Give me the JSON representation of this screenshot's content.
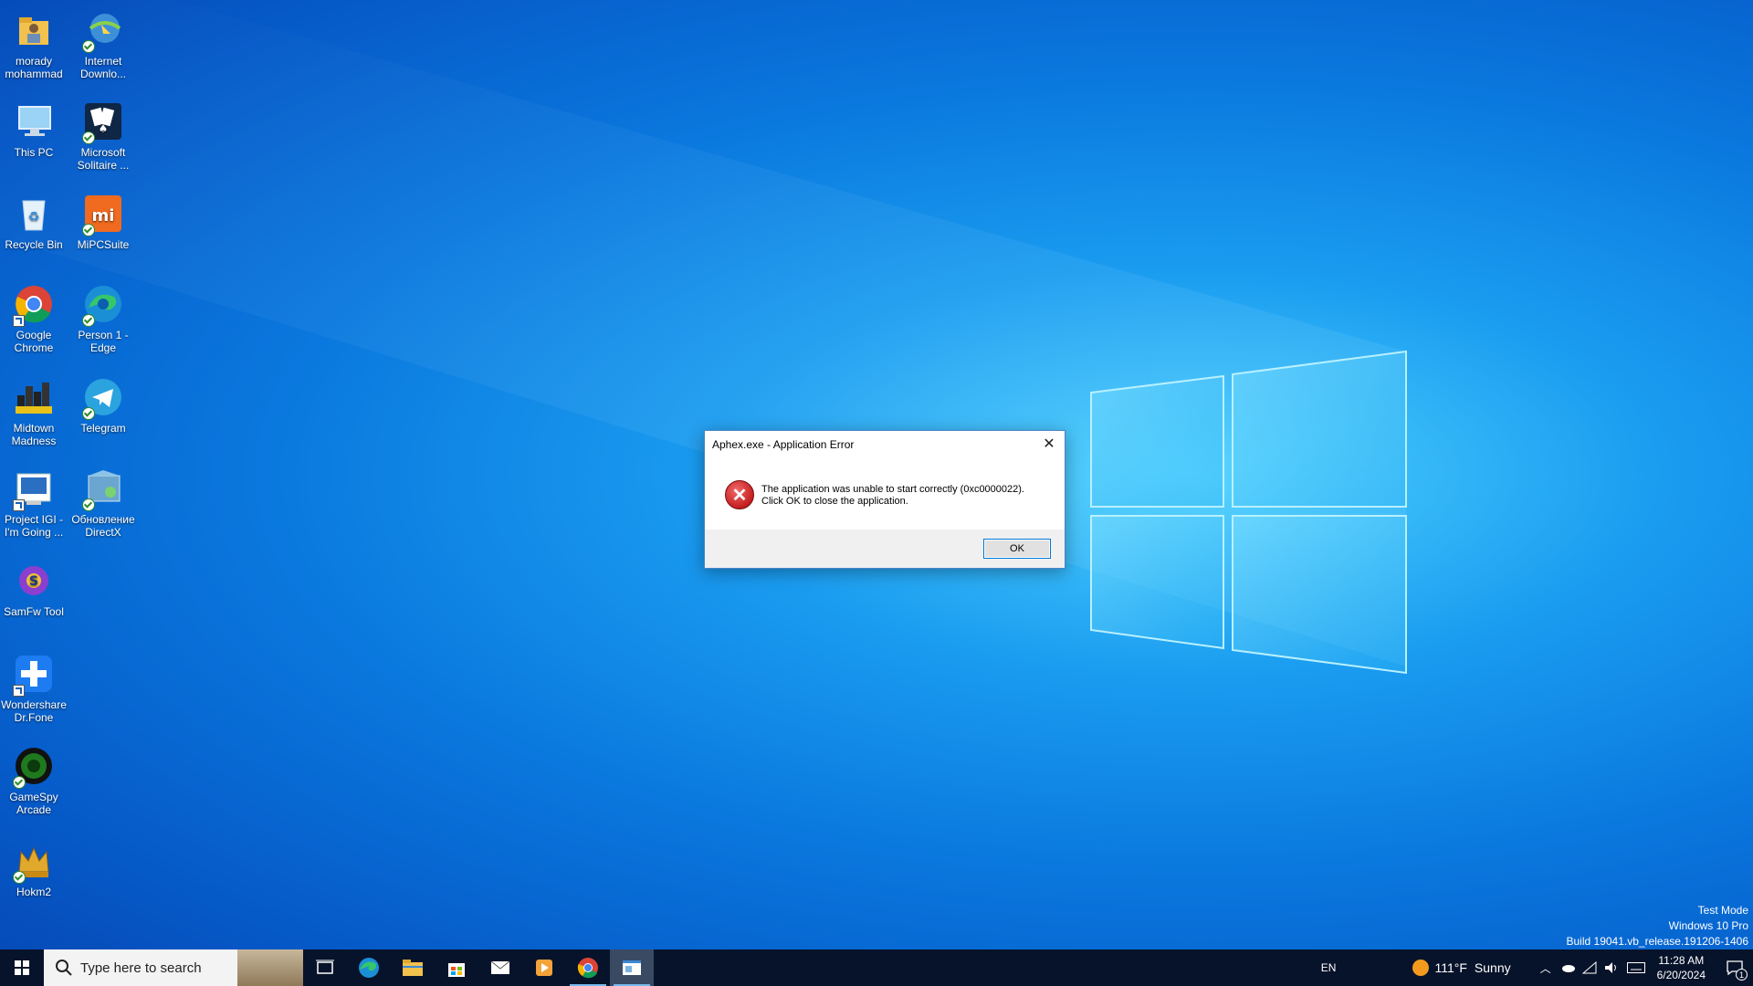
{
  "desktop": {
    "icons": [
      {
        "label": "morady mohammad",
        "icon": "user-folder-icon"
      },
      {
        "label": "Internet Downlo...",
        "icon": "internet-download-manager-icon"
      },
      {
        "label": "This PC",
        "icon": "this-pc-icon"
      },
      {
        "label": "Microsoft Solitaire ...",
        "icon": "solitaire-icon"
      },
      {
        "label": "Recycle Bin",
        "icon": "recycle-bin-icon"
      },
      {
        "label": "MiPCSuite",
        "icon": "mi-pc-suite-icon"
      },
      {
        "label": "Google Chrome",
        "icon": "chrome-icon"
      },
      {
        "label": "Person 1 - Edge",
        "icon": "edge-icon"
      },
      {
        "label": "Midtown Madness",
        "icon": "midtown-madness-icon"
      },
      {
        "label": "Telegram",
        "icon": "telegram-icon"
      },
      {
        "label": "Project IGI - I'm Going ...",
        "icon": "project-igi-icon"
      },
      {
        "label": "Обновление DirectX",
        "icon": "directx-update-icon"
      },
      {
        "label": "SamFw Tool",
        "icon": "samfw-tool-icon"
      },
      {
        "label": "Wondershare Dr.Fone",
        "icon": "drfone-icon"
      },
      {
        "label": "GameSpy Arcade",
        "icon": "gamespy-icon"
      },
      {
        "label": "Hokm2",
        "icon": "hokm2-icon"
      }
    ]
  },
  "dialog": {
    "title": "Aphex.exe - Application Error",
    "message_line1": "The application was unable to start correctly (0xc0000022).",
    "message_line2": "Click OK to close the application.",
    "ok_label": "OK",
    "close_glyph": "✕"
  },
  "watermark": {
    "line1": "Test Mode",
    "line2": "Windows 10 Pro",
    "line3": "Build 19041.vb_release.191206-1406"
  },
  "taskbar": {
    "search_placeholder": "Type here to search",
    "lang": "EN",
    "weather_temp": "111°F",
    "weather_cond": "Sunny",
    "time": "11:28 AM",
    "date": "6/20/2024",
    "notification_count": "1"
  },
  "colors": {
    "accent": "#0078d7",
    "taskbar": "#07132a",
    "error_red": "#c41e1e"
  }
}
